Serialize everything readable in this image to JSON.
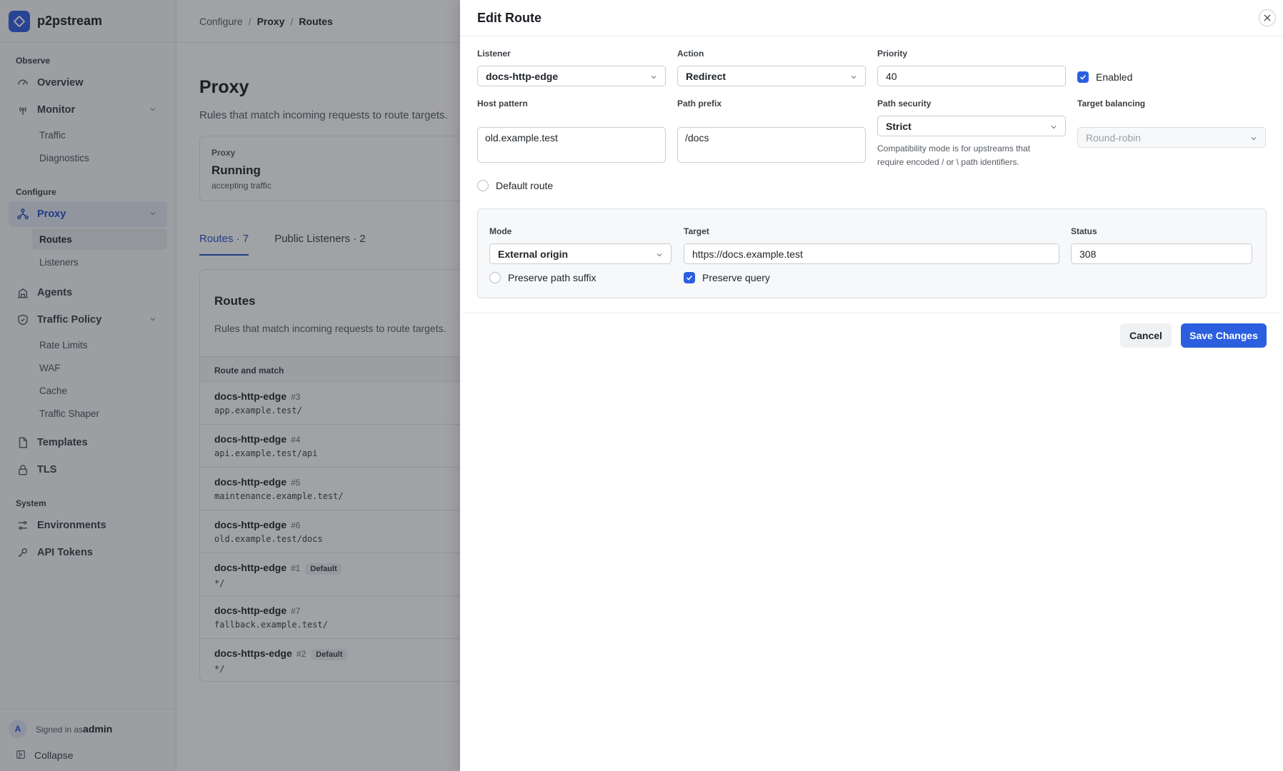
{
  "app": {
    "name": "p2pstream"
  },
  "sidebar": {
    "sections": [
      {
        "label": "Observe"
      },
      {
        "label": "Configure"
      },
      {
        "label": "System"
      }
    ],
    "items": {
      "overview": "Overview",
      "monitor": "Monitor",
      "traffic": "Traffic",
      "diagnostics": "Diagnostics",
      "proxy": "Proxy",
      "routes": "Routes",
      "listeners": "Listeners",
      "agents": "Agents",
      "traffic_policy": "Traffic Policy",
      "rate_limits": "Rate Limits",
      "waf": "WAF",
      "cache": "Cache",
      "traffic_shaper": "Traffic Shaper",
      "templates": "Templates",
      "tls": "TLS",
      "environments": "Environments",
      "api_tokens": "API Tokens"
    },
    "footer": {
      "avatar_initial": "A",
      "signed_in_prefix": "Signed in as",
      "username": "admin",
      "collapse": "Collapse"
    }
  },
  "breadcrumb": [
    "Configure",
    "Proxy",
    "Routes"
  ],
  "page": {
    "title": "Proxy",
    "subtitle": "Rules that match incoming requests to route targets.",
    "status_card": {
      "label": "Proxy",
      "value": "Running",
      "sub": "accepting traffic"
    },
    "tabs": [
      "Routes · 7",
      "Public Listeners · 2"
    ],
    "routes_card": {
      "title": "Routes",
      "subtitle": "Rules that match incoming requests to route targets.",
      "column": "Route and match",
      "rows": [
        {
          "name": "docs-http-edge",
          "num": "#3",
          "badge": "",
          "match": "app.example.test/"
        },
        {
          "name": "docs-http-edge",
          "num": "#4",
          "badge": "",
          "match": "api.example.test/api"
        },
        {
          "name": "docs-http-edge",
          "num": "#5",
          "badge": "",
          "match": "maintenance.example.test/"
        },
        {
          "name": "docs-http-edge",
          "num": "#6",
          "badge": "",
          "match": "old.example.test/docs"
        },
        {
          "name": "docs-http-edge",
          "num": "#1",
          "badge": "Default",
          "match": "*/"
        },
        {
          "name": "docs-http-edge",
          "num": "#7",
          "badge": "",
          "match": "fallback.example.test/"
        },
        {
          "name": "docs-https-edge",
          "num": "#2",
          "badge": "Default",
          "match": "*/"
        }
      ]
    }
  },
  "drawer": {
    "title": "Edit Route",
    "listener": {
      "label": "Listener",
      "value": "docs-http-edge"
    },
    "action": {
      "label": "Action",
      "value": "Redirect"
    },
    "priority": {
      "label": "Priority",
      "value": "40"
    },
    "enabled": {
      "label": "Enabled",
      "checked": true
    },
    "host_pattern": {
      "label": "Host pattern",
      "value": "old.example.test"
    },
    "path_prefix": {
      "label": "Path prefix",
      "value": "/docs"
    },
    "path_security": {
      "label": "Path security",
      "value": "Strict",
      "help": "Compatibility mode is for upstreams that require encoded / or \\ path identifiers."
    },
    "target_balancing": {
      "label": "Target balancing",
      "value": "Round-robin"
    },
    "default_route": {
      "label": "Default route",
      "checked": false
    },
    "redirect": {
      "mode": {
        "label": "Mode",
        "value": "External origin"
      },
      "target": {
        "label": "Target",
        "value": "https://docs.example.test"
      },
      "status": {
        "label": "Status",
        "value": "308"
      },
      "preserve_path_suffix": {
        "label": "Preserve path suffix",
        "checked": false
      },
      "preserve_query": {
        "label": "Preserve query",
        "checked": true
      }
    },
    "buttons": {
      "cancel": "Cancel",
      "save": "Save Changes"
    }
  },
  "colors": {
    "accent": "#2b5fe0",
    "overlay": "#1e2228"
  }
}
